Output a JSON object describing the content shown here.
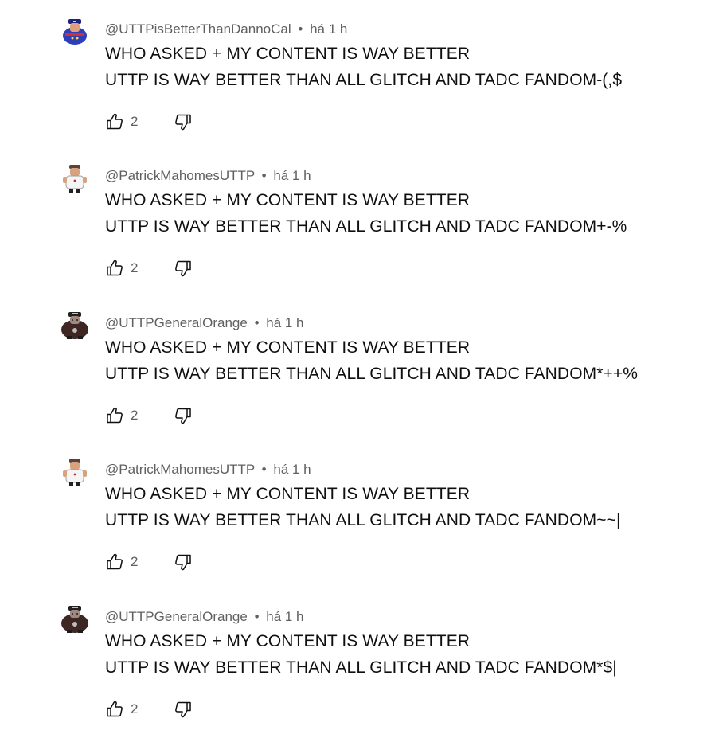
{
  "comments": [
    {
      "author": "@UTTPisBetterThanDannoCal",
      "separator": "•",
      "time": "há 1 h",
      "line1": "WHO ASKED + MY CONTENT IS WAY BETTER",
      "line2": "UTTP IS WAY BETTER THAN ALL GLITCH AND TADC FANDOM-(,$",
      "likes": "2",
      "avatar_icon": "blue-soldier-avatar-icon"
    },
    {
      "author": "@PatrickMahomesUTTP",
      "separator": "•",
      "time": "há 1 h",
      "line1": "WHO ASKED + MY CONTENT IS WAY BETTER",
      "line2": "UTTP IS WAY BETTER THAN ALL GLITCH AND TADC FANDOM+-%",
      "likes": "2",
      "avatar_icon": "white-uniform-avatar-icon"
    },
    {
      "author": "@UTTPGeneralOrange",
      "separator": "•",
      "time": "há 1 h",
      "line1": "WHO ASKED + MY CONTENT IS WAY BETTER",
      "line2": "UTTP IS WAY BETTER THAN ALL GLITCH AND TADC FANDOM*++%",
      "likes": "2",
      "avatar_icon": "brown-general-avatar-icon"
    },
    {
      "author": "@PatrickMahomesUTTP",
      "separator": "•",
      "time": "há 1 h",
      "line1": "WHO ASKED + MY CONTENT IS WAY BETTER",
      "line2": "UTTP IS WAY BETTER THAN ALL GLITCH AND TADC FANDOM~~|",
      "likes": "2",
      "avatar_icon": "white-uniform-avatar-icon"
    },
    {
      "author": "@UTTPGeneralOrange",
      "separator": "•",
      "time": "há 1 h",
      "line1": "WHO ASKED + MY CONTENT IS WAY BETTER",
      "line2": "UTTP IS WAY BETTER THAN ALL GLITCH AND TADC FANDOM*$|",
      "likes": "2",
      "avatar_icon": "brown-general-avatar-icon"
    }
  ],
  "colors": {
    "text_primary": "#0f0f0f",
    "text_secondary": "#606060",
    "background": "#ffffff"
  }
}
